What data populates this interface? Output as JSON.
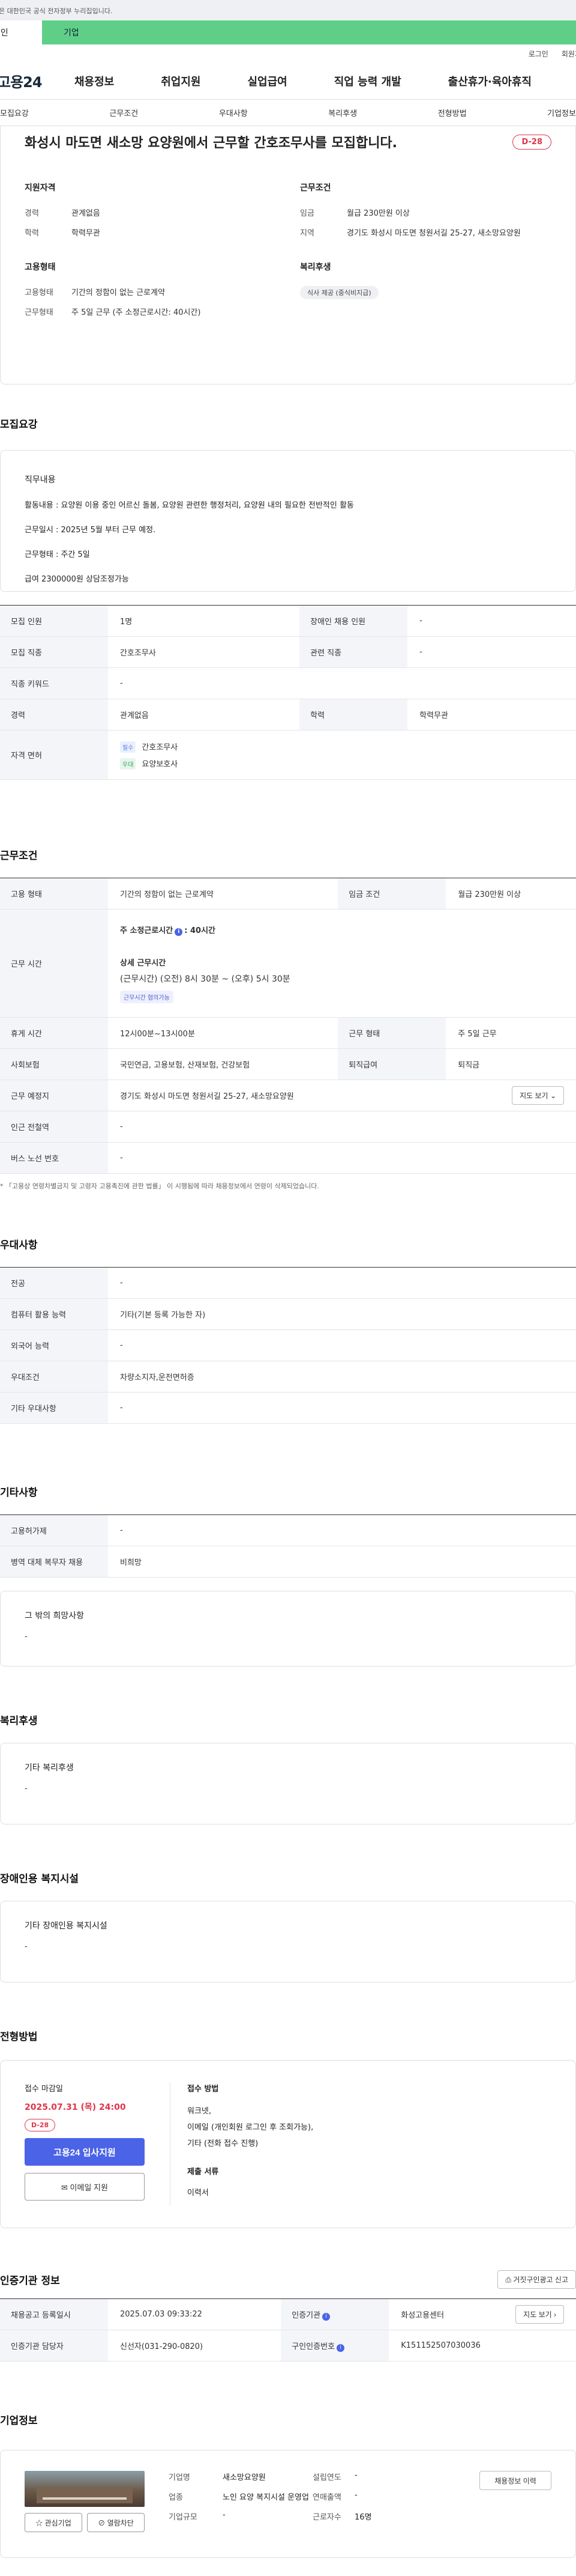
{
  "banner": {
    "text": "이 누리집은 대한민국 공식 전자정부 누리집입니다."
  },
  "user_tabs": {
    "personal": "개인",
    "company": "기업"
  },
  "util": {
    "login": "로그인",
    "join": "회원가입"
  },
  "logo": "고용24",
  "gnb": [
    "채용정보",
    "취업지원",
    "실업급여",
    "직업 능력 개발",
    "출산휴가·육아휴직"
  ],
  "subnav": [
    "모집요강",
    "근무조건",
    "우대사항",
    "복리후생",
    "전형방법",
    "기업정보"
  ],
  "summary": {
    "title": "화성시 마도면 새소망 요양원에서 근무할 간호조무사를 모집합니다.",
    "dday": "D-28",
    "qual": {
      "heading": "지원자격",
      "career_k": "경력",
      "career_v": "관계없음",
      "edu_k": "학력",
      "edu_v": "학력무관"
    },
    "cond": {
      "heading": "근무조건",
      "wage_k": "임금",
      "wage_v": "월급 230만원 이상",
      "area_k": "지역",
      "area_v": "경기도 화성시 마도면 청원서길 25-27, 새소망요양원"
    },
    "emp": {
      "heading": "고용형태",
      "type_k": "고용형태",
      "type_v": "기간의 정함이 없는 근로계약",
      "form_k": "근무형태",
      "form_v": "주 5일 근무 (주 소정근로시간: 40시간)"
    },
    "welfare": {
      "heading": "복리후생",
      "tag": "식사 제공 (중식비지급)"
    }
  },
  "recruit": {
    "title": "모집요강",
    "card_heading": "직무내용",
    "lines": [
      "활동내용 : 요양원 이용 중인 어르신 돌봄, 요양원 관련한 행정처리, 요양원 내의 필요한 전반적인 활동",
      "근무일시 : 2025년 5월 부터 근무 예정.",
      "근무형태 : 주간 5일",
      "급여 2300000원 상담조정가능"
    ],
    "rows": [
      {
        "k1": "모집 인원",
        "v1": "1명",
        "k2": "장애인 채용 인원",
        "v2": "-"
      },
      {
        "k1": "모집 직종",
        "v1": "간호조무사",
        "k2": "관련 직종",
        "v2": "-"
      },
      {
        "k1": "직종 키워드",
        "v1": "-"
      },
      {
        "k1": "경력",
        "v1": "관계없음",
        "k2": "학력",
        "v2": "학력무관"
      }
    ],
    "license_label": "자격 면허",
    "licenses": [
      {
        "tag": "필수",
        "name": "간호조무사",
        "color": "#5b7de8",
        "bg": "#eaf0ff"
      },
      {
        "tag": "우대",
        "name": "요양보호사",
        "color": "#3da35d",
        "bg": "#e6f6ea"
      }
    ]
  },
  "work": {
    "title": "근무조건",
    "type_k": "고용 형태",
    "type_v": "기간의 정함이 없는 근로계약",
    "wage_k": "임금 조건",
    "wage_v": "월급 230만원 이상",
    "hours_k": "근무 시간",
    "hours_main": "주 소정근로시간",
    "hours_main_v": ": 40시간",
    "hours_detail_h": "상세 근무시간",
    "hours_detail_v": "(근무시간) (오전) 8시 30분 ~ (오후) 5시 30분",
    "hours_badge": "근무시간 협의가능",
    "break_k": "휴게 시간",
    "break_v": "12시00분~13시00분",
    "form_k": "근무 형태",
    "form_v": "주 5일 근무",
    "ins_k": "사회보험",
    "ins_v": "국민연금, 고용보험, 산재보험, 건강보험",
    "sev_k": "퇴직급여",
    "sev_v": "퇴직금",
    "place_k": "근무 예정지",
    "place_v": "경기도 화성시 마도면 청원서길 25-27, 새소망요양원",
    "map_btn": "지도 보기",
    "subway_k": "인근 전철역",
    "subway_v": "-",
    "bus_k": "버스 노선 번호",
    "bus_v": "-",
    "note": "* 「고용상 연령차별금지 및 고령자 고용촉진에 관한 법률」 이 시행됨에 따라 채용정보에서 연령이 삭제되었습니다."
  },
  "pref": {
    "title": "우대사항",
    "rows": [
      {
        "k": "전공",
        "v": "-"
      },
      {
        "k": "컴퓨터 활용 능력",
        "v": "기타(기본 등록 가능한 자)"
      },
      {
        "k": "외국어 능력",
        "v": "-"
      },
      {
        "k": "우대조건",
        "v": "차량소지자,운전면허증"
      },
      {
        "k": "기타 우대사항",
        "v": "-"
      }
    ]
  },
  "etc": {
    "title": "기타사항",
    "rows": [
      {
        "k": "고용허가제",
        "v": "-"
      },
      {
        "k": "병역 대체 복무자 채용",
        "v": "비희망"
      }
    ],
    "card_h": "그 밖의 희망사항",
    "card_v": "-"
  },
  "welfare": {
    "title": "복리후생",
    "card_h": "기타 복리후생",
    "card_v": "-"
  },
  "disability": {
    "title": "장애인용 복지시설",
    "card_h": "기타 장애인용 복지시설",
    "card_v": "-"
  },
  "apply": {
    "title": "전형방법",
    "deadline_h": "접수 마감일",
    "deadline_v": "2025.07.31 (목) 24:00",
    "dday": "D-28",
    "btn_apply": "고용24 입사지원",
    "btn_email": "이메일 지원",
    "method_h": "접수 방법",
    "method_lines": [
      "워크넷,",
      "이메일 (개인회원 로그인 후 조회가능),",
      "기타 (전화 접수 진행)"
    ],
    "docs_h": "제출 서류",
    "docs_v": "이력서"
  },
  "cert": {
    "title": "인증기관 정보",
    "report_btn": "거짓구인광고 신고",
    "reg_k": "채용공고 등록일시",
    "reg_v": "2025.07.03 09:33:22",
    "org_k": "인증기관",
    "org_v": "화성고용센터",
    "map_btn": "지도 보기",
    "mgr_k": "인증기관 담당자",
    "mgr_v": "신선자(031-290-0820)",
    "id_k": "구인인증번호",
    "id_v": "K151152507030036"
  },
  "company": {
    "title": "기업정보",
    "btn_interest": "관심기업",
    "btn_block": "열람차단",
    "name_k": "기업명",
    "name_v": "새소망요양원",
    "year_k": "설립연도",
    "year_v": "-",
    "ind_k": "업종",
    "ind_v": "노인 요양 복지시설 운영업",
    "sales_k": "연매출액",
    "sales_v": "-",
    "emp_k": "근로자수",
    "emp_v": "16명",
    "size_k": "기업규모",
    "size_v": "-",
    "history_btn": "채용정보 이력"
  }
}
